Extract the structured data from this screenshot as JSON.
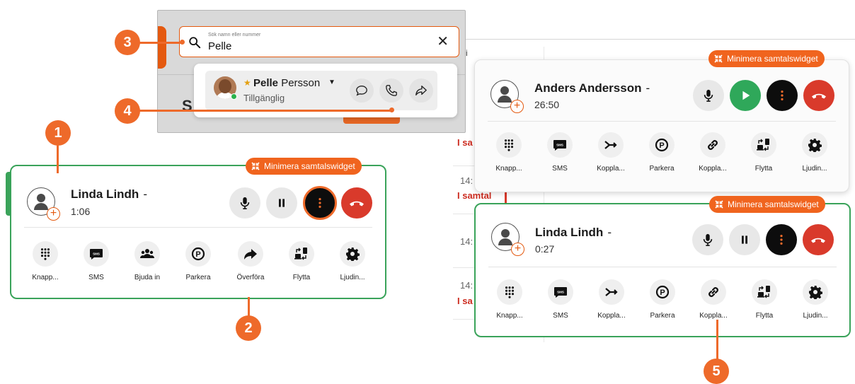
{
  "colors": {
    "accent_orange": "#ee6a2a",
    "active_green": "#3aa35a",
    "hangup_red": "#d93a2b",
    "hold_black": "#0d0d0d"
  },
  "callouts": [
    "1",
    "2",
    "3",
    "4",
    "5"
  ],
  "search": {
    "placeholder_hint": "Sök namn eller nummer",
    "value": "Pelle",
    "clear_icon": "close-icon",
    "background_heading_fragment": "S",
    "result": {
      "first_name": "Pelle",
      "last_name": "Persson",
      "status": "Tillgänglig",
      "favorite_icon": "star-icon"
    }
  },
  "history_fragments": {
    "tab_fragment": "Mi",
    "rows": [
      {
        "time": "",
        "status": "I sa"
      },
      {
        "time": "14:",
        "status": "I samtal"
      },
      {
        "time": "14:",
        "status": ""
      },
      {
        "time": "14:",
        "status": "I sa"
      }
    ]
  },
  "widget_left": {
    "minimize_label": "Minimera samtalswidget",
    "name": "Linda Lindh",
    "name_suffix": "-",
    "duration": "1:06",
    "actions": [
      {
        "label": "Knapp...",
        "icon": "keypad-icon"
      },
      {
        "label": "SMS",
        "icon": "sms-icon"
      },
      {
        "label": "Bjuda in",
        "icon": "group-icon"
      },
      {
        "label": "Parkera",
        "icon": "park-icon"
      },
      {
        "label": "Överföra",
        "icon": "forward-icon"
      },
      {
        "label": "Flytta",
        "icon": "move-device-icon"
      },
      {
        "label": "Ljudin...",
        "icon": "gear-icon"
      }
    ]
  },
  "widget_top_right": {
    "minimize_label": "Minimera samtalswidget",
    "name": "Anders Andersson",
    "name_suffix": "-",
    "duration": "26:50",
    "actions": [
      {
        "label": "Knapp...",
        "icon": "keypad-icon"
      },
      {
        "label": "SMS",
        "icon": "sms-icon"
      },
      {
        "label": "Koppla...",
        "icon": "connect-arrow-icon"
      },
      {
        "label": "Parkera",
        "icon": "park-icon"
      },
      {
        "label": "Koppla...",
        "icon": "link-icon"
      },
      {
        "label": "Flytta",
        "icon": "move-device-icon"
      },
      {
        "label": "Ljudin...",
        "icon": "gear-icon"
      }
    ]
  },
  "widget_bottom_right": {
    "minimize_label": "Minimera samtalswidget",
    "name": "Linda Lindh",
    "name_suffix": "-",
    "duration": "0:27",
    "actions": [
      {
        "label": "Knapp...",
        "icon": "keypad-icon"
      },
      {
        "label": "SMS",
        "icon": "sms-icon"
      },
      {
        "label": "Koppla...",
        "icon": "connect-arrow-icon"
      },
      {
        "label": "Parkera",
        "icon": "park-icon"
      },
      {
        "label": "Koppla...",
        "icon": "link-icon"
      },
      {
        "label": "Flytta",
        "icon": "move-device-icon"
      },
      {
        "label": "Ljudin...",
        "icon": "gear-icon"
      }
    ]
  }
}
